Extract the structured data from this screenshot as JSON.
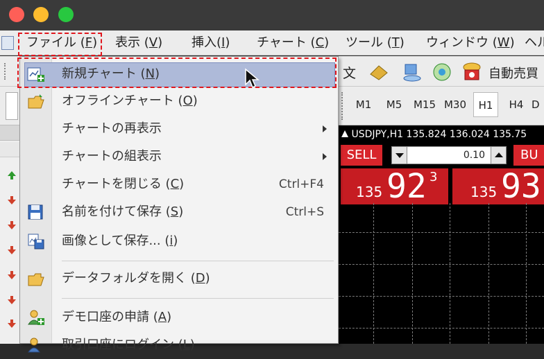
{
  "menubar": {
    "items": [
      {
        "label": "ファイル (",
        "key": "F",
        "suffix": ")"
      },
      {
        "label": "表示 (",
        "key": "V",
        "suffix": ")"
      },
      {
        "label": "挿入(",
        "key": "I",
        "suffix": ")"
      },
      {
        "label": "チャート (",
        "key": "C",
        "suffix": ")"
      },
      {
        "label": "ツール (",
        "key": "T",
        "suffix": ")"
      },
      {
        "label": "ウィンドウ (",
        "key": "W",
        "suffix": ")"
      },
      {
        "label": "ヘル",
        "key": "",
        "suffix": ""
      }
    ]
  },
  "toolbar": {
    "text_char": "文",
    "auto_trade_label": "自動売買"
  },
  "timeframes": [
    "M1",
    "M5",
    "M15",
    "M30",
    "H1",
    "H4",
    "D"
  ],
  "active_timeframe": "H1",
  "chart": {
    "title": "USDJPY,H1  135.824 136.024 135.75",
    "sell_label": "SELL",
    "buy_label": "BU",
    "lot_value": "0.10",
    "sell_price_prefix": "135",
    "sell_price_main": "92",
    "sell_price_sup": "3",
    "buy_price_prefix": "135",
    "buy_price_main": "93"
  },
  "file_menu": {
    "items": [
      {
        "label": "新規チャート (",
        "key": "N",
        "suffix": ")",
        "icon": "new-chart-icon",
        "highlighted": true
      },
      {
        "label": "オフラインチャート (",
        "key": "O",
        "suffix": ")",
        "icon": "open-folder-icon"
      },
      {
        "label": "チャートの再表示",
        "key": "",
        "suffix": "",
        "submenu": true
      },
      {
        "label": "チャートの組表示",
        "key": "",
        "suffix": "",
        "submenu": true
      },
      {
        "label": "チャートを閉じる (",
        "key": "C",
        "suffix": ")",
        "shortcut": "Ctrl+F4"
      },
      {
        "label": "名前を付けて保存 (",
        "key": "S",
        "suffix": ")",
        "shortcut": "Ctrl+S",
        "icon": "save-icon"
      },
      {
        "label": "画像として保存... (",
        "key": "i",
        "suffix": ")",
        "icon": "save-image-icon"
      },
      {
        "label": "データフォルダを開く (",
        "key": "D",
        "suffix": ")",
        "icon": "folder-icon"
      },
      {
        "label": "デモ口座の申請 (",
        "key": "A",
        "suffix": ")",
        "icon": "user-add-icon"
      },
      {
        "label": "取引口座にログイン (",
        "key": "L",
        "suffix": ")",
        "icon": "user-login-icon"
      }
    ]
  },
  "colors": {
    "highlight": "#aebad9",
    "annotation_red": "#e0161d",
    "price_red": "#c61c22"
  }
}
